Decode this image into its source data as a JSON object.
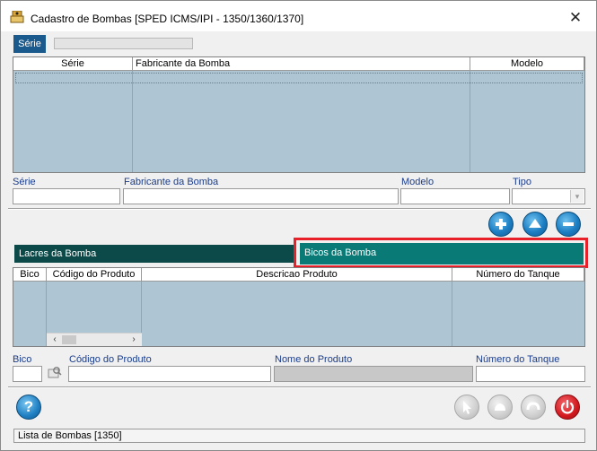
{
  "window": {
    "title": "Cadastro de Bombas  [SPED ICMS/IPI - 1350/1360/1370]",
    "close_glyph": "✕"
  },
  "top_tab": {
    "label": "Série"
  },
  "bombas_grid": {
    "columns": [
      "Série",
      "Fabricante da Bomba",
      "Modelo"
    ]
  },
  "bomba_form": {
    "serie_label": "Série",
    "fabricante_label": "Fabricante da Bomba",
    "modelo_label": "Modelo",
    "tipo_label": "Tipo",
    "serie_value": "",
    "fabricante_value": "",
    "modelo_value": "",
    "tipo_value": ""
  },
  "sub_tabs": [
    {
      "label": "Lacres da Bomba",
      "active": false
    },
    {
      "label": "Bicos da Bomba",
      "active": true
    }
  ],
  "bicos_grid": {
    "columns": [
      "Bico",
      "Código do Produto",
      "Descricao Produto",
      "Número do Tanque"
    ]
  },
  "bico_form": {
    "bico_label": "Bico",
    "codigo_label": "Código do Produto",
    "nome_label": "Nome do Produto",
    "tanque_label": "Número do Tanque",
    "bico_value": "",
    "codigo_value": "",
    "nome_value": "",
    "tanque_value": ""
  },
  "icons": {
    "add": "plus-icon",
    "up": "arrow-up-icon",
    "remove": "minus-icon",
    "help": "question-icon",
    "power": "power-icon"
  },
  "colors": {
    "tab_active": "#1a5a8c",
    "subtab_dark": "#0b4a48",
    "subtab_active": "#0a7a76",
    "grid_bg": "#aec6d4",
    "label_blue": "#1a3d8c",
    "highlight": "#e8202a"
  },
  "statusbar": {
    "text": "Lista de Bombas [1350]"
  }
}
